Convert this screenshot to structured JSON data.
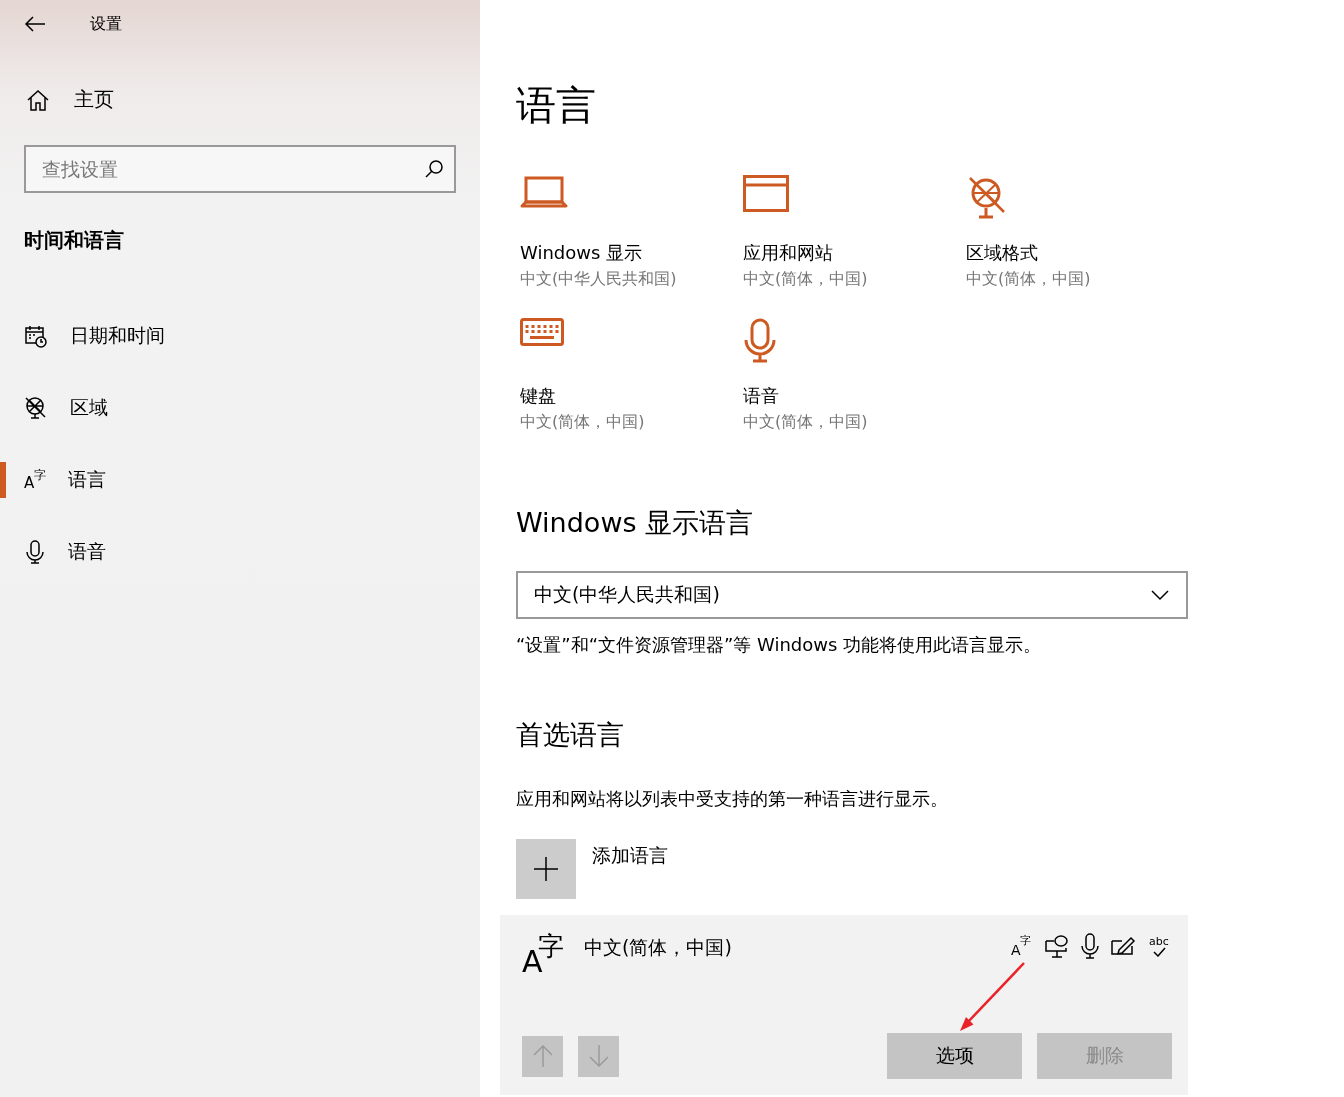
{
  "window": {
    "title": "设置"
  },
  "sidebar": {
    "home": "主页",
    "search": {
      "placeholder": "查找设置"
    },
    "section_title": "时间和语言",
    "items": [
      {
        "kind": "calendar",
        "label": "日期和时间",
        "selected": false
      },
      {
        "kind": "globe",
        "label": "区域",
        "selected": false
      },
      {
        "kind": "language",
        "glyph_a": "A",
        "glyph_b": "字",
        "label": "语言",
        "selected": true
      },
      {
        "kind": "mic",
        "label": "语音",
        "selected": false
      }
    ]
  },
  "page": {
    "title": "语言",
    "tiles": [
      {
        "kind": "laptop",
        "title": "Windows 显示",
        "subtitle": "中文(中华人民共和国)"
      },
      {
        "kind": "window",
        "title": "应用和网站",
        "subtitle": "中文(简体，中国)"
      },
      {
        "kind": "globe",
        "title": "区域格式",
        "subtitle": "中文(简体，中国)"
      },
      {
        "kind": "keyboard",
        "title": "键盘",
        "subtitle": "中文(简体，中国)"
      },
      {
        "kind": "mic",
        "title": "语音",
        "subtitle": "中文(简体，中国)"
      }
    ],
    "display_language": {
      "heading": "Windows 显示语言",
      "value": "中文(中华人民共和国)",
      "note": "“设置”和“文件资源管理器”等 Windows 功能将使用此语言显示。"
    },
    "preferred": {
      "heading": "首选语言",
      "note": "应用和网站将以列表中受支持的第一种语言进行显示。",
      "add_label": "添加语言",
      "languages": [
        {
          "name": "中文(简体，中国)",
          "glyph_a": "A",
          "glyph_b": "字",
          "selected": true,
          "features": [
            {
              "kind": "language_pack",
              "glyph_a": "A",
              "glyph_b": "字"
            },
            {
              "kind": "speech_display"
            },
            {
              "kind": "mic"
            },
            {
              "kind": "handwriting"
            },
            {
              "kind": "spelling",
              "glyph": "abc"
            }
          ],
          "move_up": {
            "disabled": true
          },
          "move_down": {
            "disabled": true
          },
          "buttons": [
            {
              "label": "选项",
              "disabled": false
            },
            {
              "label": "删除",
              "disabled": true
            }
          ]
        }
      ]
    }
  },
  "annotation": {
    "arrow": true
  }
}
